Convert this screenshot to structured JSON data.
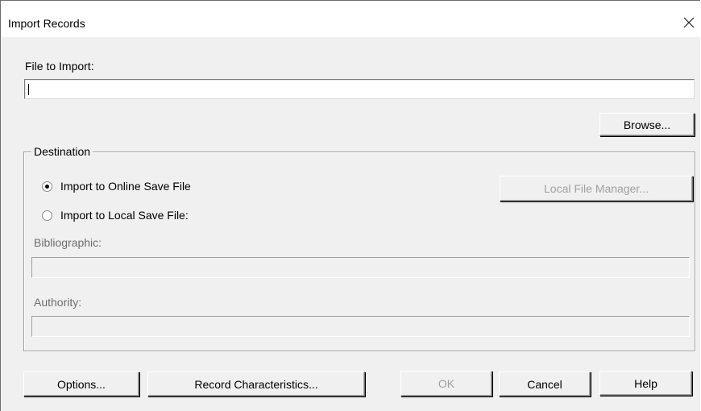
{
  "window": {
    "title": "Import Records"
  },
  "file_import": {
    "label": "File to Import:",
    "value": "",
    "browse_label": "Browse..."
  },
  "destination": {
    "group_label": "Destination",
    "options": [
      {
        "label": "Import to Online Save File",
        "selected": true
      },
      {
        "label": "Import to Local Save File:",
        "selected": false
      }
    ],
    "local_file_manager_label": "Local File Manager...",
    "bibliographic_label": "Bibliographic:",
    "bibliographic_value": "",
    "authority_label": "Authority:",
    "authority_value": ""
  },
  "buttons": {
    "options": "Options...",
    "record_characteristics": "Record Characteristics...",
    "ok": "OK",
    "cancel": "Cancel",
    "help": "Help"
  },
  "icons": {
    "close": "close-icon",
    "radio_selected": "radio-selected-icon",
    "radio_empty": "radio-empty-icon"
  }
}
